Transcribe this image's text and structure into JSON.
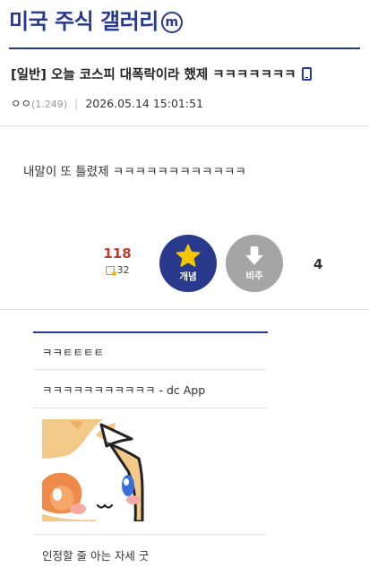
{
  "header": {
    "gallery_title": "미국 주식 갤러리",
    "minor_badge": "m"
  },
  "post": {
    "title": "[일반] 오늘 코스피 대폭락이라 했제 ㅋㅋㅋㅋㅋㅋㅋ",
    "author": "ㅇㅇ",
    "author_ip": "(1.249)",
    "meta_separator": "|",
    "datetime": "2026.05.14 15:01:51",
    "body": "내말이 또 틀렸제 ㅋㅋㅋㅋㅋㅋㅋㅋㅋㅋㅋㅋ"
  },
  "votes": {
    "recommend_count": "118",
    "fixed_recommend_count": "32",
    "recommend_label": "개념",
    "nonrecommend_label": "비추",
    "nonrecommend_count": "4"
  },
  "comments": [
    {
      "text": "ㅋㅋㅌㅌㅌㅌ"
    },
    {
      "text": "ㅋㅋㅋㅋㅋㅋㅋㅋㅋㅋㅋ - dc App"
    },
    {
      "text": "인정할 줄 아는 자세 굿"
    }
  ],
  "colors": {
    "brand": "#293a8c",
    "recommend_count": "#c0392b",
    "downvote_button": "#a5a5a5",
    "star": "#f5c500"
  },
  "icons": {
    "upvote": "star-icon",
    "downvote": "arrow-down-icon",
    "fixed": "fixed-recommend-icon",
    "mobile": "mobile-device-icon"
  }
}
